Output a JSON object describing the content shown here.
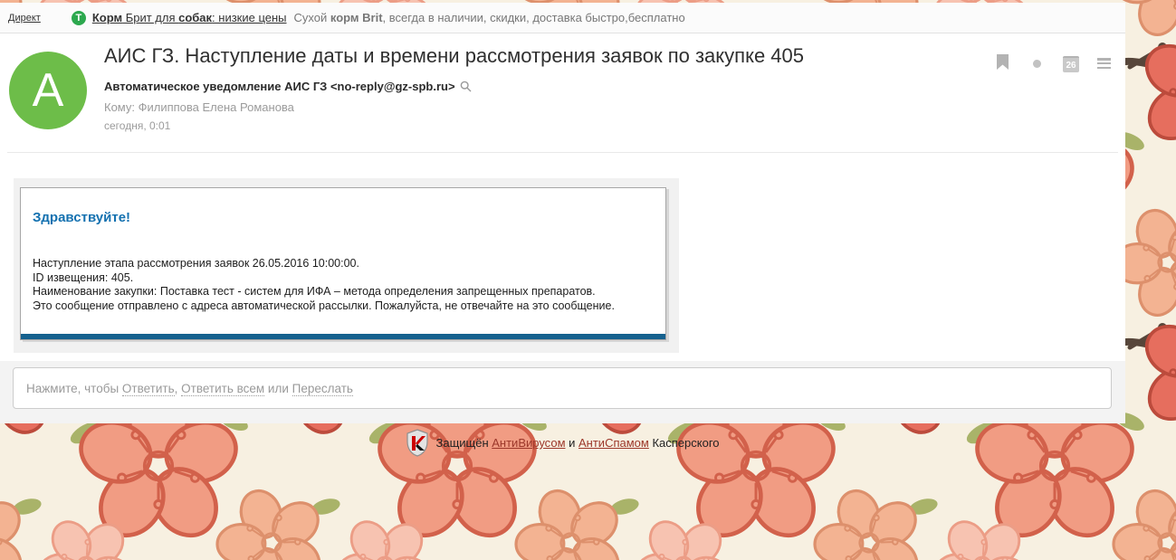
{
  "ad_bar": {
    "direct_label": "Директ",
    "ad_icon_letter": "T",
    "ad_link_segments": [
      {
        "text": "Корм",
        "bold": true
      },
      {
        "text": " Брит для ",
        "bold": false
      },
      {
        "text": "собак",
        "bold": true
      },
      {
        "text": ": низкие цены",
        "bold": false
      }
    ],
    "ad_description_segments": [
      {
        "text": "Сухой ",
        "bold": false
      },
      {
        "text": "корм Brit",
        "bold": true
      },
      {
        "text": ", всегда в наличии, скидки, доставка быстро,бесплатно",
        "bold": false
      }
    ]
  },
  "email_header": {
    "avatar_letter": "A",
    "subject": "АИС ГЗ. Наступление даты и времени рассмотрения заявок по закупке 405",
    "from_text": "Автоматическое уведомление АИС ГЗ <no-reply@gz-spb.ru>",
    "to_text": "Кому: Филиппова Елена Романова",
    "date_text": "сегодня, 0:01",
    "calendar_badge": "26"
  },
  "message_body": {
    "greeting": "Здравствуйте!",
    "lines": [
      "Наступление этапа рассмотрения заявок 26.05.2016 10:00:00.",
      "ID извещения: 405.",
      "Наименование закупки: Поставка тест - систем для ИФА – метода определения запрещенных препаратов.",
      "Это сообщение отправлено с адреса автоматической рассылки. Пожалуйста, не отвечайте на это сообщение."
    ]
  },
  "reply_bar": {
    "segments": [
      {
        "text": "Нажмите, чтобы ",
        "link": false
      },
      {
        "text": "Ответить",
        "link": true
      },
      {
        "text": ", ",
        "link": false
      },
      {
        "text": "Ответить всем",
        "link": true
      },
      {
        "text": " или ",
        "link": false
      },
      {
        "text": "Переслать",
        "link": true
      }
    ]
  },
  "footer": {
    "shield_letter": "K",
    "segments": [
      {
        "text": "Защищён ",
        "link": false
      },
      {
        "text": "АнтиВирусом",
        "link": true
      },
      {
        "text": " и ",
        "link": false
      },
      {
        "text": "АнтиСпамом",
        "link": true
      },
      {
        "text": " Касперского",
        "link": false
      }
    ]
  },
  "colors": {
    "avatar_green": "#6dbd49",
    "ad_icon_green": "#2ca84e",
    "greeting_blue": "#1471b0",
    "message_accent_bar": "#15618e",
    "kaspersky_red": "#cc0000",
    "footer_link_red": "#9c372a",
    "background_cream": "#f7f0e1",
    "flower_salmon": "#f19c83",
    "flower_red": "#e66e5e",
    "flower_pink": "#f7c3b1",
    "branch_brown": "#57463a",
    "leaf_green": "#a9b369"
  }
}
